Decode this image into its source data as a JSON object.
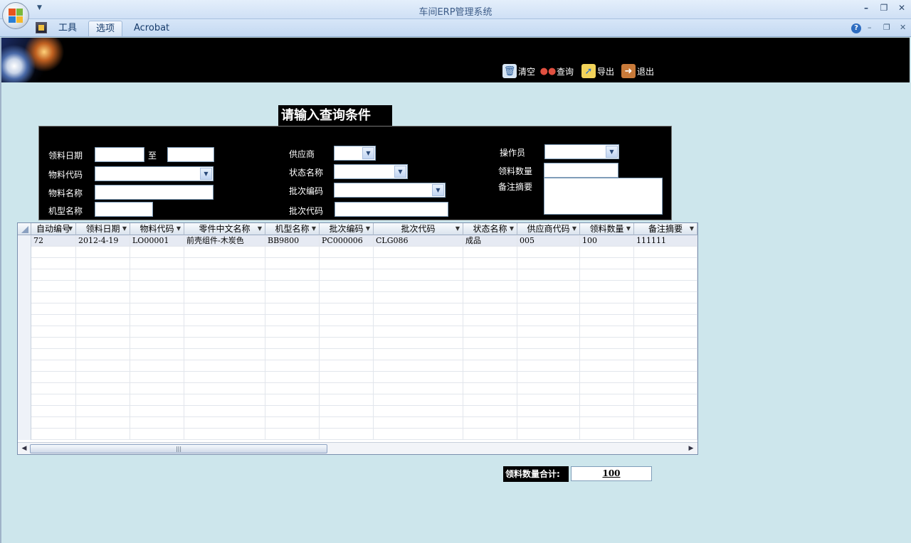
{
  "window": {
    "title": "车间ERP管理系统",
    "minimize": "–",
    "restore": "❐",
    "close": "✕"
  },
  "ribbon": {
    "tabs": [
      "工具",
      "选项",
      "Acrobat"
    ],
    "active_tab": "选项",
    "help": "?",
    "minimize": "–",
    "restore": "❐",
    "close": "✕"
  },
  "toolbar": {
    "clear_label": "清空",
    "query_label": "查询",
    "export_label": "导出",
    "exit_label": "退出"
  },
  "query": {
    "title": "请输入查询条件",
    "fields": {
      "issue_date": "领料日期",
      "to": "至",
      "material_code": "物料代码",
      "material_name": "物料名称",
      "model_name": "机型名称",
      "supplier": "供应商",
      "status_name": "状态名称",
      "batch_code": "批次编码",
      "batch_no": "批次代码",
      "operator": "操作员",
      "issue_qty": "领料数量",
      "remarks": "备注摘要"
    }
  },
  "grid": {
    "columns": [
      "自动编号",
      "领料日期",
      "物料代码",
      "零件中文名称",
      "机型名称",
      "批次编码",
      "批次代码",
      "状态名称",
      "供应商代码",
      "领料数量",
      "备注摘要"
    ],
    "rows": [
      [
        "72",
        "2012-4-19",
        "LO00001",
        "前壳组件-木炭色",
        "BB9800",
        "PC000006",
        "CLG086",
        "成品",
        "005",
        "100",
        "111111"
      ]
    ],
    "scroll_grip": "|||",
    "scroll_left": "◀",
    "scroll_right": "▶"
  },
  "totals": {
    "label": "领料数量合计:",
    "value": "100"
  },
  "icons": {
    "dropdown": "▼",
    "header_sort": "▼"
  },
  "colors": {
    "background": "#cde6ec",
    "banner": "#000000",
    "grid_selected_row": "#e6eaf3"
  }
}
